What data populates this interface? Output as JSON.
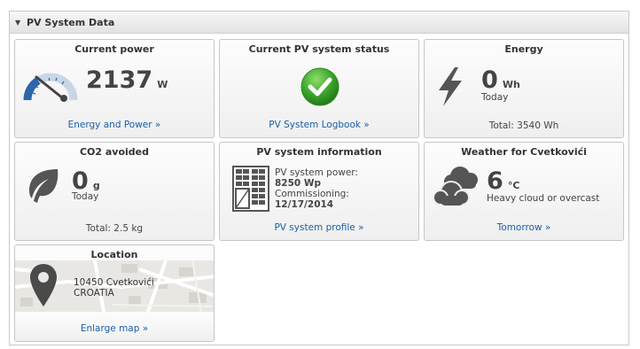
{
  "panel": {
    "title": "PV System Data"
  },
  "current_power": {
    "title": "Current power",
    "value": "2137",
    "unit": "W",
    "link": "Energy and Power »"
  },
  "status": {
    "title": "Current PV system status",
    "link": "PV System Logbook »"
  },
  "energy": {
    "title": "Energy",
    "value": "0",
    "unit": "Wh",
    "period": "Today",
    "total": "Total: 3540 Wh"
  },
  "co2": {
    "title": "CO2 avoided",
    "value": "0",
    "unit": "g",
    "period": "Today",
    "total": "Total: 2.5 kg"
  },
  "pv_info": {
    "title": "PV system information",
    "power_label": "PV system power:",
    "power_value": "8250 Wp",
    "commissioning_label": "Commissioning:",
    "commissioning_value": "12/17/2014",
    "link": "PV system profile »"
  },
  "weather": {
    "title": "Weather for Cvetkovići",
    "value": "6",
    "unit": "°C",
    "condition": "Heavy cloud or overcast",
    "link": "Tomorrow »"
  },
  "location": {
    "title": "Location",
    "address_line1": "10450 Cvetkovići",
    "address_line2": "CROATIA",
    "link": "Enlarge map »"
  },
  "colors": {
    "link": "#1a5fa8",
    "status_ok": "#3aa52a",
    "icon_gray": "#555555",
    "gauge_blue": "#2f66a8"
  }
}
